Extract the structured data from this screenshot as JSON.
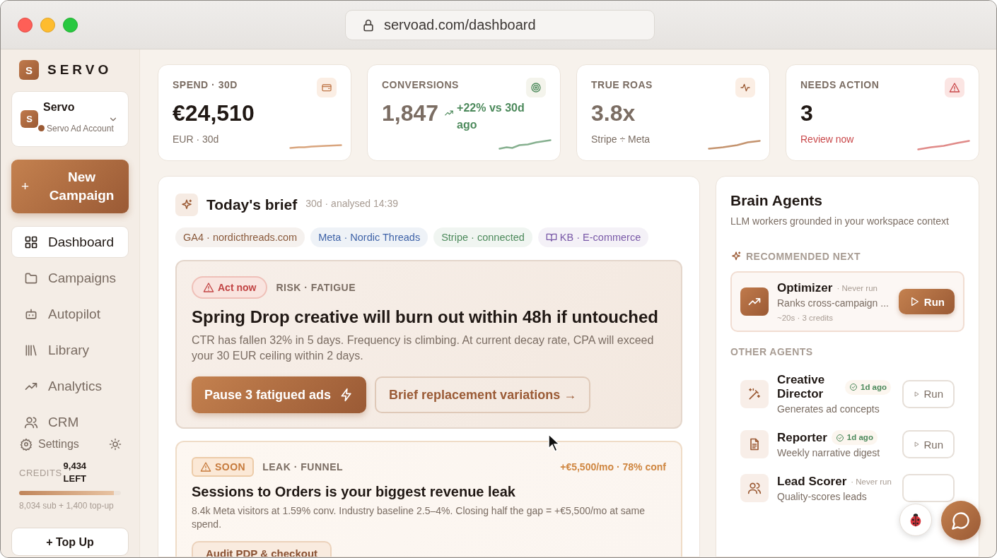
{
  "browser": {
    "url": "servoad.com/dashboard"
  },
  "sidebar": {
    "brand": {
      "initial": "S",
      "name": "SERVO"
    },
    "account": {
      "initial": "S",
      "name": "Servo",
      "subtitle": "Servo Ad Account"
    },
    "new_button": {
      "icon": "+",
      "label": "New Campaign"
    },
    "nav": [
      {
        "label": "Dashboard",
        "selected": true
      },
      {
        "label": "Campaigns",
        "selected": false
      },
      {
        "label": "Autopilot",
        "selected": false
      },
      {
        "label": "Library",
        "selected": false
      },
      {
        "label": "Analytics",
        "selected": false
      },
      {
        "label": "CRM",
        "selected": false
      }
    ],
    "settings": "Settings",
    "credits": {
      "label": "CREDITS",
      "value": "9,434 LEFT",
      "level": 0.93,
      "detail": "8,034 sub + 1,400 top-up"
    },
    "top_up": "+ Top Up"
  },
  "kpis": [
    {
      "kind": "spend",
      "label": "SPEND · 30D",
      "value": "€24,510",
      "sub": "EUR · 30d"
    },
    {
      "kind": "conversions",
      "label": "CONVERSIONS",
      "value": "1,847",
      "delta": "+22% vs 30d ago"
    },
    {
      "kind": "roas",
      "label": "TRUE ROAS",
      "value": "3.8x",
      "sub": "Stripe ÷ Meta"
    },
    {
      "kind": "action",
      "label": "NEEDS ACTION",
      "value": "3",
      "sub": "Review now"
    }
  ],
  "brief": {
    "title": "Today's brief",
    "meta": "30d · analysed 14:39",
    "sources": [
      {
        "label": "GA4 · nordicthreads.com",
        "color": "#8a5a3c"
      },
      {
        "label": "Meta · Nordic Threads",
        "color": "#3f63a8"
      },
      {
        "label": "Stripe · connected",
        "color": "#4d8a5c"
      },
      {
        "label": "KB · E-commerce",
        "color": "#7a5aa8",
        "book": true
      }
    ],
    "insights": [
      {
        "kind": "urgent",
        "badge": "Act now",
        "tag": "RISK · FATIGUE",
        "title": "Spring Drop creative will burn out within 48h if untouched",
        "body": "CTR has fallen 32% in 5 days. Frequency is climbing. At current decay rate, CPA will exceed your 30 EUR ceiling within 2 days.",
        "actions": [
          {
            "kind": "primary",
            "label": "Pause 3 fatigued ads"
          },
          {
            "kind": "secondary",
            "label": "Brief replacement variations →"
          }
        ]
      },
      {
        "kind": "soon",
        "badge": "SOON",
        "tag": "LEAK · FUNNEL",
        "impact": "+€5,500/mo · 78% conf",
        "title": "Sessions to Orders is your biggest revenue leak",
        "body": "8.4k Meta visitors at 1.59% conv. Industry baseline 2.5–4%. Closing half the gap = +€5,500/mo at same spend.",
        "actions": [
          {
            "kind": "outline",
            "label": "Audit PDP & checkout"
          }
        ]
      }
    ]
  },
  "agents": {
    "title": "Brain Agents",
    "subtitle": "LLM workers grounded in your workspace context",
    "recommended_heading": "RECOMMENDED NEXT",
    "recommended": {
      "name": "Optimizer",
      "status": "· Never run",
      "description": "Ranks cross-campaign ...",
      "meta": "~20s · 3 credits",
      "run": "Run"
    },
    "other_heading": "OTHER AGENTS",
    "others": [
      {
        "name": "Creative Director",
        "kind": "ran",
        "status": "1d ago",
        "description": "Generates ad concepts",
        "run": "Run"
      },
      {
        "name": "Reporter",
        "kind": "ran",
        "status": "1d ago",
        "description": "Weekly narrative digest",
        "run": "Run"
      },
      {
        "name": "Lead Scorer",
        "kind": "never",
        "status": "· Never run",
        "description": "Quality-scores leads"
      }
    ]
  }
}
